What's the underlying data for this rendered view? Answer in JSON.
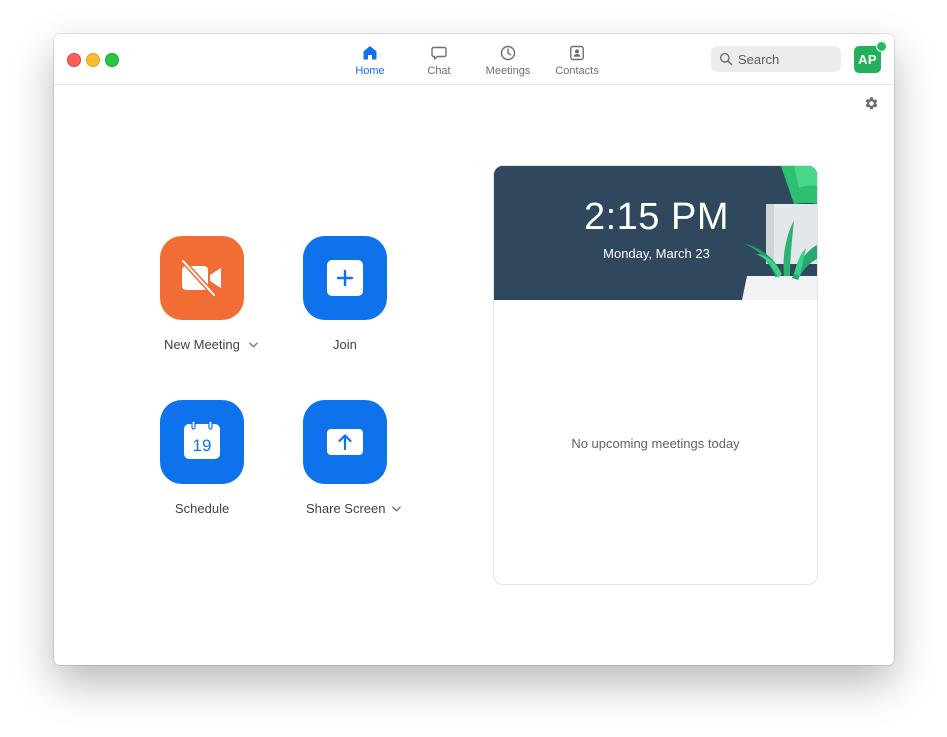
{
  "nav": {
    "tabs": [
      {
        "label": "Home",
        "icon": "home-icon",
        "active": true
      },
      {
        "label": "Chat",
        "icon": "chat-bubble-icon",
        "active": false
      },
      {
        "label": "Meetings",
        "icon": "clock-icon",
        "active": false
      },
      {
        "label": "Contacts",
        "icon": "contact-card-icon",
        "active": false
      }
    ]
  },
  "search": {
    "placeholder": "Search"
  },
  "user": {
    "initials": "AP",
    "status": "online"
  },
  "actions": {
    "new_meeting": "New Meeting",
    "join": "Join",
    "schedule": "Schedule",
    "calendar_day": "19",
    "share_screen": "Share Screen"
  },
  "upcoming": {
    "time": "2:15 PM",
    "date": "Monday, March 23",
    "empty_message": "No upcoming meetings today"
  },
  "colors": {
    "accent": "#0e72ed",
    "new_meeting": "#f26d36",
    "avatar": "#23b05d",
    "header_bg": "#2d4459"
  }
}
